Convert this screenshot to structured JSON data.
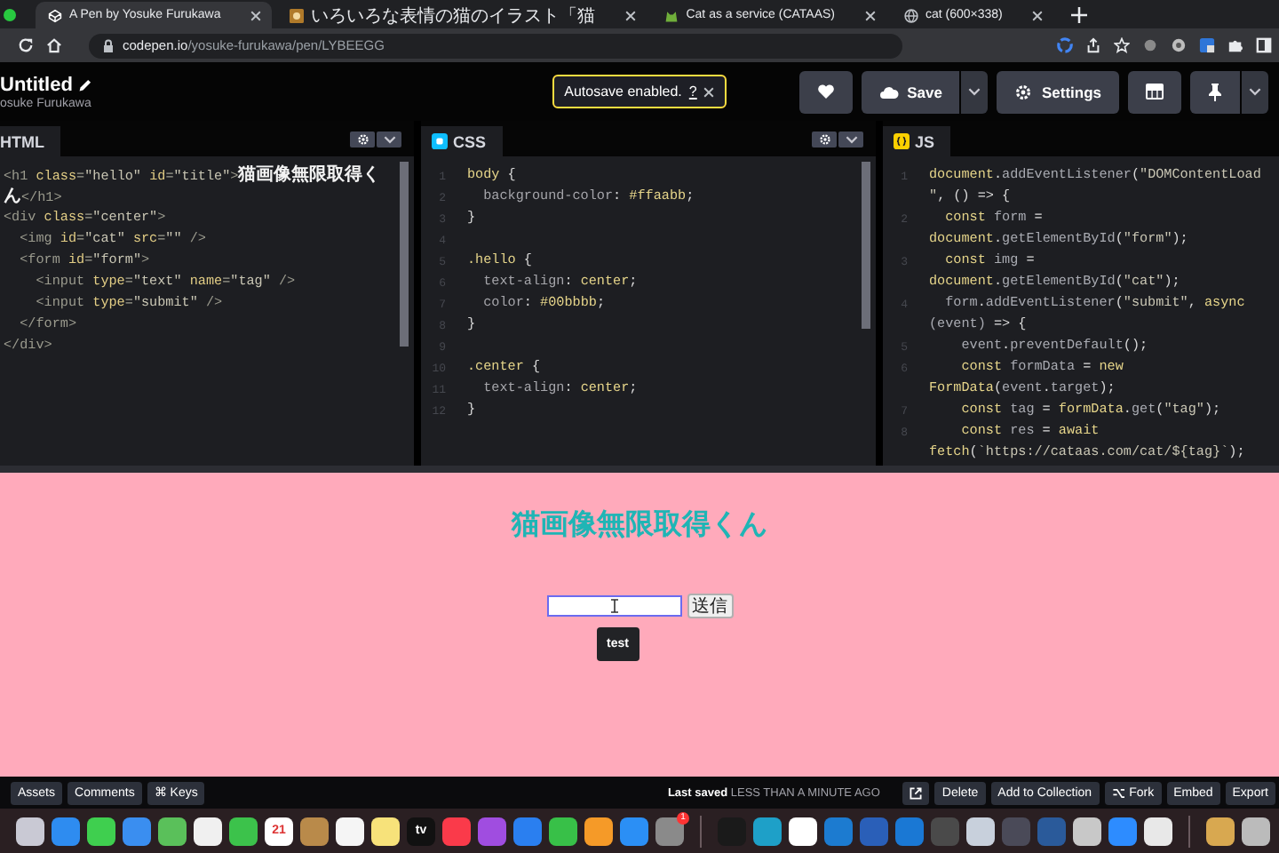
{
  "browser": {
    "tabs": [
      {
        "title": "A Pen by Yosuke Furukawa",
        "selected": true
      },
      {
        "title": "いろいろな表情の猫のイラスト「猫",
        "selected": false
      },
      {
        "title": "Cat as a service (CATAAS)",
        "selected": false
      },
      {
        "title": "cat (600×338)",
        "selected": false
      }
    ],
    "url": {
      "host": "codepen.io",
      "path": "/yosuke-furukawa/pen/LYBEEGG"
    }
  },
  "header": {
    "title": "Untitled",
    "author": "osuke Furukawa",
    "toast": {
      "text": "Autosave enabled.",
      "help": "?"
    },
    "buttons": [
      {
        "kind": "heart"
      },
      {
        "kind": "save",
        "label": "Save"
      },
      {
        "kind": "settings",
        "label": "Settings"
      },
      {
        "kind": "layout"
      },
      {
        "kind": "pin"
      }
    ]
  },
  "panes": [
    {
      "kind": "html",
      "label": "HTML",
      "settings_buttons": true,
      "scrollbar": true,
      "lines": [
        {
          "tokens": [
            {
              "kind": "tag",
              "text": "<h1 "
            },
            {
              "kind": "attr",
              "text": "class"
            },
            {
              "kind": "tag",
              "text": "="
            },
            {
              "kind": "str",
              "text": "\"hello\" "
            },
            {
              "kind": "attr",
              "text": "id"
            },
            {
              "kind": "tag",
              "text": "="
            },
            {
              "kind": "str",
              "text": "\"title\""
            },
            {
              "kind": "tag",
              "text": ">"
            },
            {
              "kind": "cjk",
              "text": "猫画像無限取得く"
            }
          ]
        },
        {
          "tokens": [
            {
              "kind": "cjk",
              "text": "ん"
            },
            {
              "kind": "tag",
              "text": "</h1>"
            }
          ]
        },
        {
          "tokens": [
            {
              "kind": "tag",
              "text": "<div "
            },
            {
              "kind": "attr",
              "text": "class"
            },
            {
              "kind": "tag",
              "text": "="
            },
            {
              "kind": "str",
              "text": "\"center\""
            },
            {
              "kind": "tag",
              "text": ">"
            }
          ]
        },
        {
          "tokens": [
            {
              "kind": "tag",
              "text": "  <img "
            },
            {
              "kind": "attr",
              "text": "id"
            },
            {
              "kind": "tag",
              "text": "="
            },
            {
              "kind": "str",
              "text": "\"cat\" "
            },
            {
              "kind": "attr",
              "text": "src"
            },
            {
              "kind": "tag",
              "text": "="
            },
            {
              "kind": "str",
              "text": "\"\" "
            },
            {
              "kind": "tag",
              "text": "/>"
            }
          ]
        },
        {
          "tokens": [
            {
              "kind": "tag",
              "text": "  <form "
            },
            {
              "kind": "attr",
              "text": "id"
            },
            {
              "kind": "tag",
              "text": "="
            },
            {
              "kind": "str",
              "text": "\"form\""
            },
            {
              "kind": "tag",
              "text": ">"
            }
          ]
        },
        {
          "tokens": [
            {
              "kind": "tag",
              "text": "    <input "
            },
            {
              "kind": "attr",
              "text": "type"
            },
            {
              "kind": "tag",
              "text": "="
            },
            {
              "kind": "str",
              "text": "\"text\" "
            },
            {
              "kind": "attr",
              "text": "name"
            },
            {
              "kind": "tag",
              "text": "="
            },
            {
              "kind": "str",
              "text": "\"tag\" "
            },
            {
              "kind": "tag",
              "text": "/>"
            }
          ]
        },
        {
          "tokens": [
            {
              "kind": "tag",
              "text": "    <input "
            },
            {
              "kind": "attr",
              "text": "type"
            },
            {
              "kind": "tag",
              "text": "="
            },
            {
              "kind": "str",
              "text": "\"submit\" "
            },
            {
              "kind": "tag",
              "text": "/>"
            }
          ]
        },
        {
          "tokens": [
            {
              "kind": "tag",
              "text": "  </form>"
            }
          ]
        },
        {
          "tokens": [
            {
              "kind": "tag",
              "text": "</div>"
            }
          ]
        }
      ]
    },
    {
      "kind": "css",
      "label": "CSS",
      "settings_buttons": true,
      "scrollbar": true,
      "lines": [
        {
          "num": "1",
          "tokens": [
            {
              "kind": "sel",
              "text": "body"
            },
            {
              "kind": "punc",
              "text": " {"
            }
          ]
        },
        {
          "num": "2",
          "tokens": [
            {
              "kind": "prop",
              "text": "  background-color"
            },
            {
              "kind": "punc",
              "text": ": "
            },
            {
              "kind": "val",
              "text": "#ffaabb"
            },
            {
              "kind": "punc",
              "text": ";"
            }
          ]
        },
        {
          "num": "3",
          "tokens": [
            {
              "kind": "punc",
              "text": "}"
            }
          ]
        },
        {
          "num": "4"
        },
        {
          "num": "5",
          "tokens": [
            {
              "kind": "sel",
              "text": ".hello"
            },
            {
              "kind": "punc",
              "text": " {"
            }
          ]
        },
        {
          "num": "6",
          "tokens": [
            {
              "kind": "prop",
              "text": "  text-align"
            },
            {
              "kind": "punc",
              "text": ": "
            },
            {
              "kind": "val",
              "text": "center"
            },
            {
              "kind": "punc",
              "text": ";"
            }
          ]
        },
        {
          "num": "7",
          "tokens": [
            {
              "kind": "prop",
              "text": "  color"
            },
            {
              "kind": "punc",
              "text": ": "
            },
            {
              "kind": "val",
              "text": "#00bbbb"
            },
            {
              "kind": "punc",
              "text": ";"
            }
          ]
        },
        {
          "num": "8",
          "tokens": [
            {
              "kind": "punc",
              "text": "}"
            }
          ]
        },
        {
          "num": "9"
        },
        {
          "num": "10",
          "tokens": [
            {
              "kind": "sel",
              "text": ".center"
            },
            {
              "kind": "punc",
              "text": " {"
            }
          ]
        },
        {
          "num": "11",
          "tokens": [
            {
              "kind": "prop",
              "text": "  text-align"
            },
            {
              "kind": "punc",
              "text": ": "
            },
            {
              "kind": "val",
              "text": "center"
            },
            {
              "kind": "punc",
              "text": ";"
            }
          ]
        },
        {
          "num": "12",
          "tokens": [
            {
              "kind": "punc",
              "text": "}"
            }
          ]
        }
      ]
    },
    {
      "kind": "js",
      "label": "JS",
      "settings_buttons": false,
      "scrollbar": false,
      "lines": [
        {
          "num": "1",
          "tokens": [
            {
              "kind": "obj",
              "text": "document"
            },
            {
              "kind": "punc",
              "text": "."
            },
            {
              "kind": "fn",
              "text": "addEventListener"
            },
            {
              "kind": "punc",
              "text": "("
            },
            {
              "kind": "str",
              "text": "\"DOMContentLoad"
            }
          ]
        },
        {
          "tokens": [
            {
              "kind": "str",
              "text": "\""
            },
            {
              "kind": "punc",
              "text": ", () => {"
            }
          ]
        },
        {
          "num": "2",
          "tokens": [
            {
              "kind": "kw",
              "text": "  const "
            },
            {
              "kind": "fn",
              "text": "form"
            },
            {
              "kind": "punc",
              "text": " ="
            }
          ]
        },
        {
          "tokens": [
            {
              "kind": "obj",
              "text": "document"
            },
            {
              "kind": "punc",
              "text": "."
            },
            {
              "kind": "fn",
              "text": "getElementById"
            },
            {
              "kind": "punc",
              "text": "("
            },
            {
              "kind": "str",
              "text": "\"form\""
            },
            {
              "kind": "punc",
              "text": ");"
            }
          ]
        },
        {
          "num": "3",
          "tokens": [
            {
              "kind": "kw",
              "text": "  const "
            },
            {
              "kind": "fn",
              "text": "img"
            },
            {
              "kind": "punc",
              "text": " ="
            }
          ]
        },
        {
          "tokens": [
            {
              "kind": "obj",
              "text": "document"
            },
            {
              "kind": "punc",
              "text": "."
            },
            {
              "kind": "fn",
              "text": "getElementById"
            },
            {
              "kind": "punc",
              "text": "("
            },
            {
              "kind": "str",
              "text": "\"cat\""
            },
            {
              "kind": "punc",
              "text": ");"
            }
          ]
        },
        {
          "num": "4",
          "tokens": [
            {
              "kind": "fn",
              "text": "  form"
            },
            {
              "kind": "punc",
              "text": "."
            },
            {
              "kind": "fn",
              "text": "addEventListener"
            },
            {
              "kind": "punc",
              "text": "("
            },
            {
              "kind": "str",
              "text": "\"submit\""
            },
            {
              "kind": "punc",
              "text": ", "
            },
            {
              "kind": "kw",
              "text": "async"
            }
          ]
        },
        {
          "tokens": [
            {
              "kind": "fn",
              "text": "(event)"
            },
            {
              "kind": "punc",
              "text": " => {"
            }
          ]
        },
        {
          "num": "5",
          "tokens": [
            {
              "kind": "fn",
              "text": "    event"
            },
            {
              "kind": "punc",
              "text": "."
            },
            {
              "kind": "fn",
              "text": "preventDefault"
            },
            {
              "kind": "punc",
              "text": "();"
            }
          ]
        },
        {
          "num": "6",
          "tokens": [
            {
              "kind": "kw",
              "text": "    const "
            },
            {
              "kind": "fn",
              "text": "formData"
            },
            {
              "kind": "punc",
              "text": " = "
            },
            {
              "kind": "kw",
              "text": "new"
            }
          ]
        },
        {
          "tokens": [
            {
              "kind": "obj",
              "text": "FormData"
            },
            {
              "kind": "punc",
              "text": "("
            },
            {
              "kind": "fn",
              "text": "event"
            },
            {
              "kind": "punc",
              "text": "."
            },
            {
              "kind": "fn",
              "text": "target"
            },
            {
              "kind": "punc",
              "text": ");"
            }
          ]
        },
        {
          "num": "7",
          "tokens": [
            {
              "kind": "kw",
              "text": "    const "
            },
            {
              "kind": "fn",
              "text": "tag"
            },
            {
              "kind": "punc",
              "text": " = "
            },
            {
              "kind": "obj",
              "text": "formData"
            },
            {
              "kind": "punc",
              "text": "."
            },
            {
              "kind": "fn",
              "text": "get"
            },
            {
              "kind": "punc",
              "text": "("
            },
            {
              "kind": "str",
              "text": "\"tag\""
            },
            {
              "kind": "punc",
              "text": ");"
            }
          ]
        },
        {
          "num": "8",
          "tokens": [
            {
              "kind": "kw",
              "text": "    const "
            },
            {
              "kind": "fn",
              "text": "res"
            },
            {
              "kind": "punc",
              "text": " = "
            },
            {
              "kind": "kw",
              "text": "await"
            }
          ]
        },
        {
          "tokens": [
            {
              "kind": "obj",
              "text": "fetch"
            },
            {
              "kind": "punc",
              "text": "("
            },
            {
              "kind": "str",
              "text": "`https://cataas.com/cat/${tag}`"
            },
            {
              "kind": "punc",
              "text": ");"
            }
          ]
        }
      ]
    }
  ],
  "preview": {
    "title": "猫画像無限取得くん",
    "submit": "送信",
    "tooltip": "test"
  },
  "footer": {
    "left_buttons": [
      "Assets",
      "Comments",
      "⌘ Keys"
    ],
    "saved": "**Last saved** LESS THAN A MINUTE AGO",
    "right_buttons": [
      {
        "kind": "external"
      },
      {
        "kind": "text",
        "label": "Delete"
      },
      {
        "kind": "text",
        "label": "Add to Collection"
      },
      {
        "kind": "fork",
        "label": "Fork"
      },
      {
        "kind": "text",
        "label": "Embed"
      },
      {
        "kind": "text",
        "label": "Export"
      }
    ]
  },
  "dock": {
    "groups": [
      [
        {
          "color": "#c9c9d4"
        },
        {
          "color": "#2e8cf0"
        },
        {
          "color": "#3fcf4f"
        },
        {
          "color": "#3a8ef0"
        },
        {
          "color": "#5ac05a"
        },
        {
          "color": "#f0f0f0"
        },
        {
          "color": "#3cc24b"
        },
        {
          "color": "#ffffff",
          "label": "21"
        },
        {
          "color": "#b98a4a"
        },
        {
          "color": "#f5f5f5"
        },
        {
          "color": "#f7e27a"
        },
        {
          "color": "#111111",
          "label": "tv"
        },
        {
          "color": "#fa3a4a"
        },
        {
          "color": "#a04de0"
        },
        {
          "color": "#2a7ff0"
        },
        {
          "color": "#38c048"
        },
        {
          "color": "#f59a28"
        },
        {
          "color": "#2b8ff5"
        },
        {
          "color": "#8a8a8a",
          "badge": "1"
        }
      ],
      [
        {
          "color": "#1a1a1a"
        },
        {
          "color": "#1ea0c8"
        },
        {
          "color": "#ffffff"
        },
        {
          "color": "#1c7bd0"
        },
        {
          "color": "#2a5fb8"
        },
        {
          "color": "#1a78d4"
        },
        {
          "color": "#4a4a4a"
        },
        {
          "color": "#c8d0dc"
        },
        {
          "color": "#4a4a58"
        },
        {
          "color": "#2a5a9a"
        },
        {
          "color": "#c8c8c8"
        },
        {
          "color": "#2d8cff"
        },
        {
          "color": "#e8e8e8"
        }
      ],
      [
        {
          "color": "#d8a850"
        },
        {
          "color": "#bbbbbb"
        }
      ]
    ]
  }
}
